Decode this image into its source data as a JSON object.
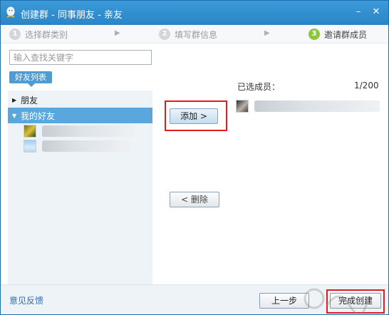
{
  "window": {
    "title": "创建群 - 同事朋友 - 亲友",
    "minimize_glyph": "–",
    "close_glyph": "✕"
  },
  "steps": [
    {
      "number": "1",
      "label": "选择群类别",
      "active": false
    },
    {
      "number": "2",
      "label": "填写群信息",
      "active": false
    },
    {
      "number": "3",
      "label": "邀请群成员",
      "active": true
    }
  ],
  "search": {
    "placeholder": "输入查找关键字",
    "value": ""
  },
  "friends_tab_label": "好友列表",
  "groups": [
    {
      "label": "朋友",
      "expanded": false
    },
    {
      "label": "我的好友",
      "expanded": true
    }
  ],
  "buttons": {
    "add_label": "添加 >",
    "delete_label": "< 删除",
    "prev_label": "上一步",
    "finish_label": "完成创建"
  },
  "selected": {
    "label": "已选成员：",
    "count": "1/200"
  },
  "footer": {
    "feedback_label": "意见反馈"
  },
  "colors": {
    "titlebar": "#2a85c6",
    "selected_row": "#5aa7de",
    "highlight_box": "#e21c1c",
    "step_active": "#8cc63f"
  },
  "icons": {
    "app_logo": "qq-penguin-icon",
    "collapsed": "triangle-right-icon",
    "expanded": "triangle-down-icon"
  }
}
